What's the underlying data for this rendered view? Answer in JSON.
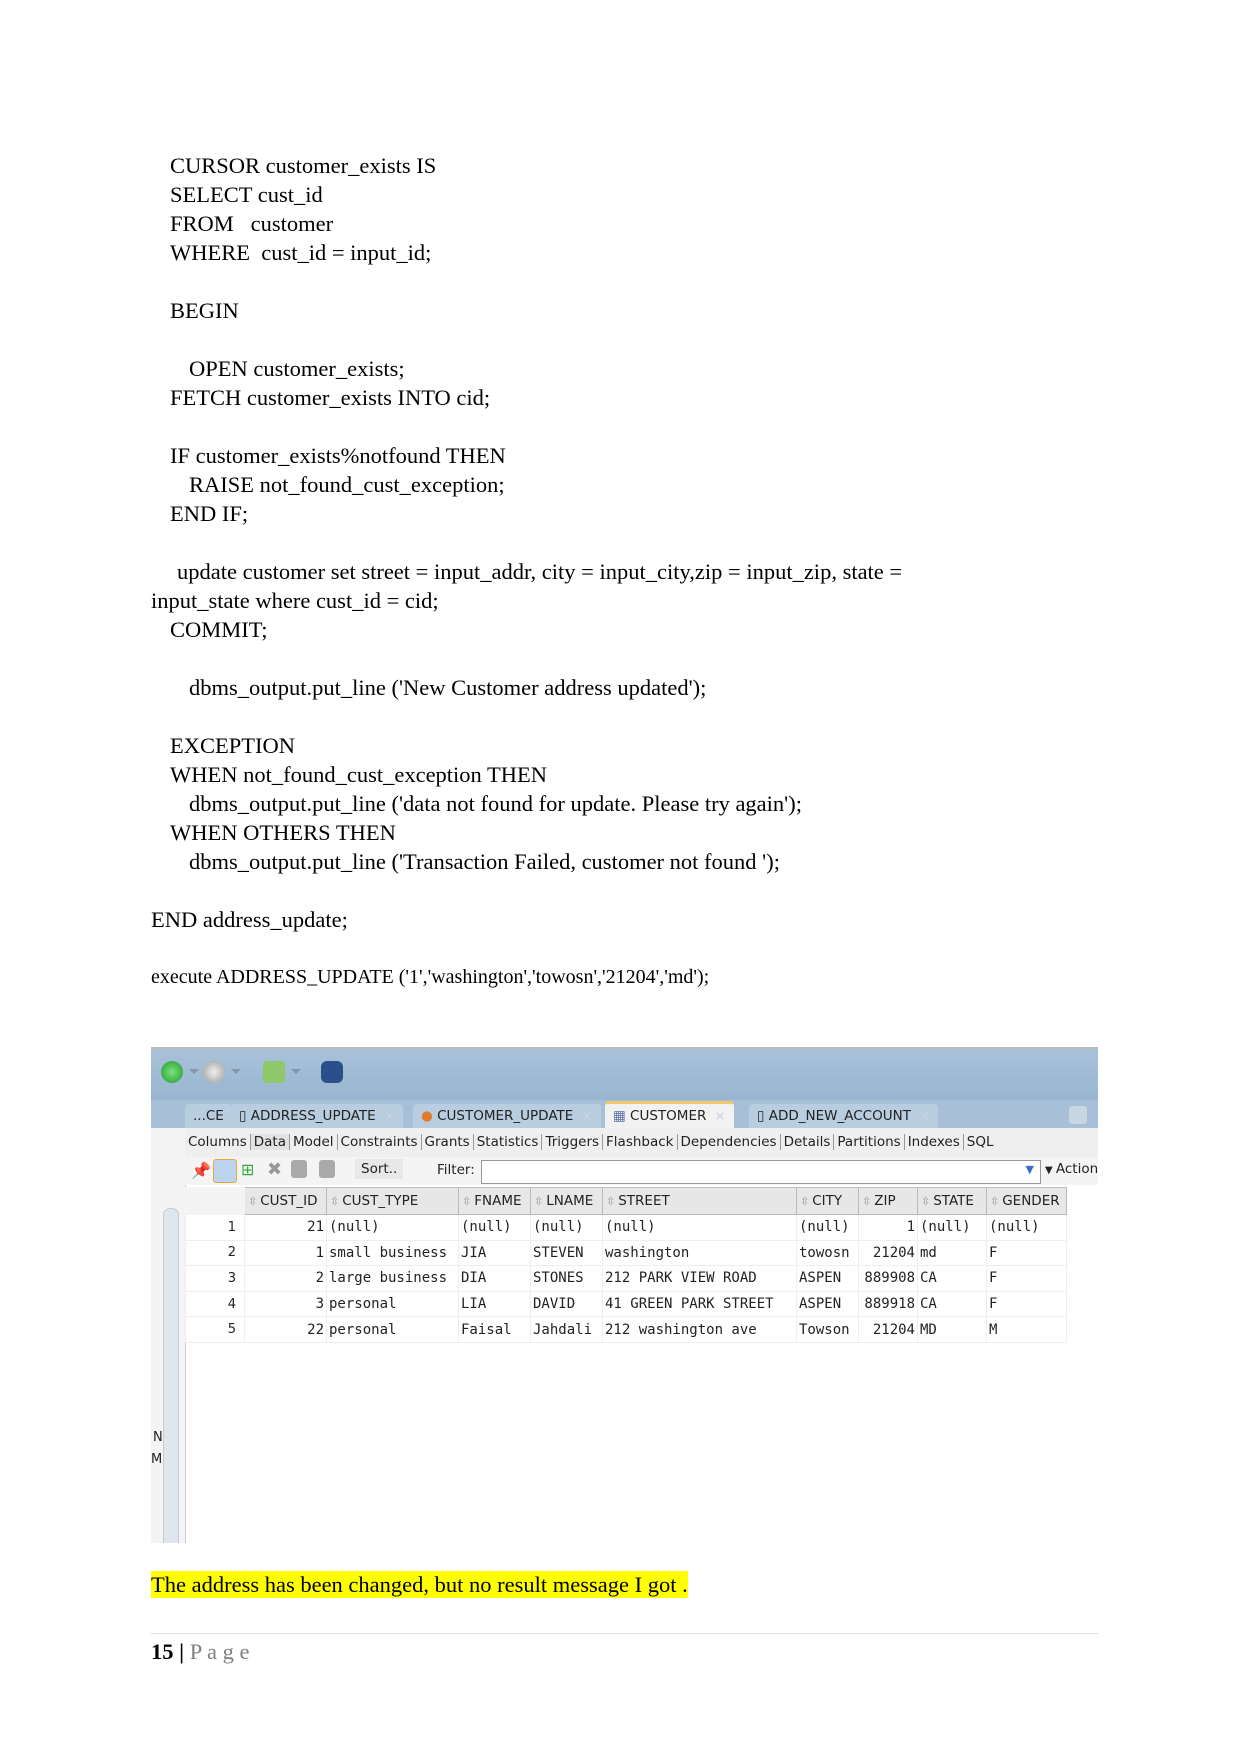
{
  "code": {
    "lines": [
      "CURSOR customer_exists IS",
      "SELECT cust_id",
      "FROM   customer",
      "WHERE  cust_id = input_id;",
      "",
      "BEGIN",
      "",
      "OPEN customer_exists;",
      "FETCH customer_exists INTO cid;",
      "",
      "IF customer_exists%notfound THEN",
      "RAISE not_found_cust_exception;",
      "END IF;",
      "",
      "update customer set street = input_addr, city = input_city,zip = input_zip, state =",
      "input_state where cust_id = cid;",
      "COMMIT;",
      "",
      "dbms_output.put_line ('New Customer address updated');",
      "",
      "EXCEPTION",
      "WHEN not_found_cust_exception THEN",
      "dbms_output.put_line ('data not found for update. Please try again');",
      "WHEN OTHERS THEN",
      "dbms_output.put_line ('Transaction Failed, customer not found ');",
      "",
      "END address_update;",
      "",
      "execute ADDRESS_UPDATE ('1','washington','towosn','21204','md');"
    ]
  },
  "screenshot": {
    "tabs": [
      "...CE",
      "ADDRESS_UPDATE",
      "CUSTOMER_UPDATE",
      "CUSTOMER",
      "ADD_NEW_ACCOUNT"
    ],
    "subtabs": [
      "Columns",
      "Data",
      "Model",
      "Constraints",
      "Grants",
      "Statistics",
      "Triggers",
      "Flashback",
      "Dependencies",
      "Details",
      "Partitions",
      "Indexes",
      "SQL"
    ],
    "sort_label": "Sort..",
    "filter_label": "Filter:",
    "filter_value": "",
    "actions_label": "Action",
    "gutter_letters": [
      "N",
      "M"
    ],
    "columns": [
      "CUST_ID",
      "CUST_TYPE",
      "FNAME",
      "LNAME",
      "STREET",
      "CITY",
      "ZIP",
      "STATE",
      "GENDER"
    ],
    "rows": [
      [
        "1",
        "21",
        "(null)",
        "(null)",
        "(null)",
        "(null)",
        "(null)",
        "1",
        "(null)",
        "(null)"
      ],
      [
        "2",
        "1",
        "small business",
        "JIA",
        "STEVEN",
        "washington",
        "towosn",
        "21204",
        "md",
        "F"
      ],
      [
        "3",
        "2",
        "large business",
        "DIA",
        "STONES",
        "212  PARK VIEW ROAD",
        "ASPEN",
        "889908",
        "CA",
        "F"
      ],
      [
        "4",
        "3",
        "personal",
        "LIA",
        "DAVID",
        "41   GREEN PARK STREET",
        "ASPEN",
        "889918",
        "CA",
        "F"
      ],
      [
        "5",
        "22",
        "personal",
        "Faisal",
        "Jahdali",
        "212 washington ave",
        "Towson",
        "21204",
        "MD",
        "M"
      ]
    ]
  },
  "note": "The address has been changed, but no result message I got .",
  "footer": {
    "page_number": "15",
    "separator": "|",
    "page_label": "P a g e"
  },
  "colors": {
    "highlight": "#ffff00",
    "toolbar": "#a3bdd6"
  }
}
